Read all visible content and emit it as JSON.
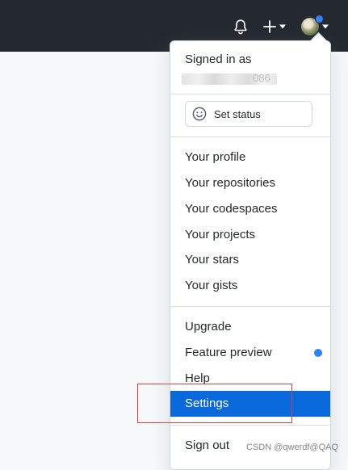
{
  "topbar": {
    "icons": [
      "bell-icon",
      "plus-icon",
      "avatar"
    ],
    "colors": {
      "background": "#24292f",
      "avatar_dot": "#2f81f7"
    }
  },
  "menu": {
    "signed_in_label": "Signed in as",
    "username_visible_fragment": "086",
    "status_button_label": "Set status",
    "status_icon": "smiley-icon",
    "profile_items": [
      "Your profile",
      "Your repositories",
      "Your codespaces",
      "Your projects",
      "Your stars",
      "Your gists"
    ],
    "extra_items": [
      "Upgrade",
      "Feature preview",
      "Help",
      "Settings"
    ],
    "active_item": "Settings",
    "sign_out_label": "Sign out",
    "colors": {
      "active_bg": "#0969da",
      "feature_dot": "#2f81f7",
      "annotation_box": "#e03a3a"
    }
  },
  "watermark": "CSDN @qwerdf@QAQ"
}
